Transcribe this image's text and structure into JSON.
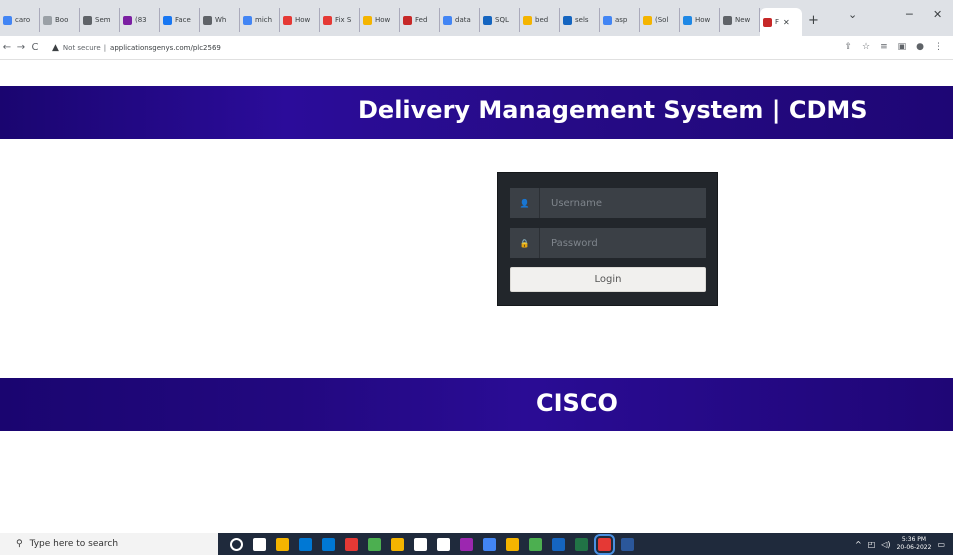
{
  "browser": {
    "tabs": [
      {
        "label": "caro",
        "color": "#4285f4"
      },
      {
        "label": "Boo",
        "color": "#9aa0a6"
      },
      {
        "label": "Sem",
        "color": "#5f6368"
      },
      {
        "label": "(83",
        "color": "#7b1fa2"
      },
      {
        "label": "Face",
        "color": "#1877f2"
      },
      {
        "label": "Wh",
        "color": "#5f6368"
      },
      {
        "label": "mich",
        "color": "#4285f4"
      },
      {
        "label": "How",
        "color": "#e53935"
      },
      {
        "label": "Fix S",
        "color": "#e53935"
      },
      {
        "label": "How",
        "color": "#f4b400"
      },
      {
        "label": "Fed",
        "color": "#c62828"
      },
      {
        "label": "data",
        "color": "#4285f4"
      },
      {
        "label": "SQL",
        "color": "#1565c0"
      },
      {
        "label": "bed",
        "color": "#f4b400"
      },
      {
        "label": "sels",
        "color": "#1565c0"
      },
      {
        "label": "asp",
        "color": "#4285f4"
      },
      {
        "label": "(Sol",
        "color": "#f4b400"
      },
      {
        "label": "How",
        "color": "#1e88e5"
      },
      {
        "label": "New",
        "color": "#5f6368"
      }
    ],
    "active_tab": {
      "label": "F",
      "color": "#c62828",
      "close": "✕"
    },
    "new_tab": "+",
    "window_controls": {
      "chevron": "⌄",
      "minimize": "─",
      "close": "✕"
    },
    "nav": {
      "back": "←",
      "forward": "→",
      "reload": "C"
    },
    "address": {
      "warning_icon": "▲",
      "security_text": "Not secure",
      "url": "applicationsgenys.com/plc2569"
    }
  },
  "page": {
    "header_title": "Delivery Management System | CDMS",
    "footer_title": "CISCO",
    "login": {
      "username_placeholder": "Username",
      "password_placeholder": "Password",
      "login_label": "Login",
      "user_icon": "👤",
      "lock_icon": "🔒"
    }
  },
  "taskbar": {
    "search_placeholder": "Type here to search",
    "clock_time": "5:36 PM",
    "clock_date": "20-06-2022",
    "apps": [
      "#ffffff",
      "#ffffff",
      "#f4b400",
      "#0078d4",
      "#0078d4",
      "#e53935",
      "#4caf50",
      "#f4b400",
      "#ffffff",
      "#ffffff",
      "#9c27b0",
      "#4285f4",
      "#f4b400",
      "#4caf50",
      "#1565c0",
      "#217346",
      "#e53935",
      "#2b579a"
    ]
  }
}
